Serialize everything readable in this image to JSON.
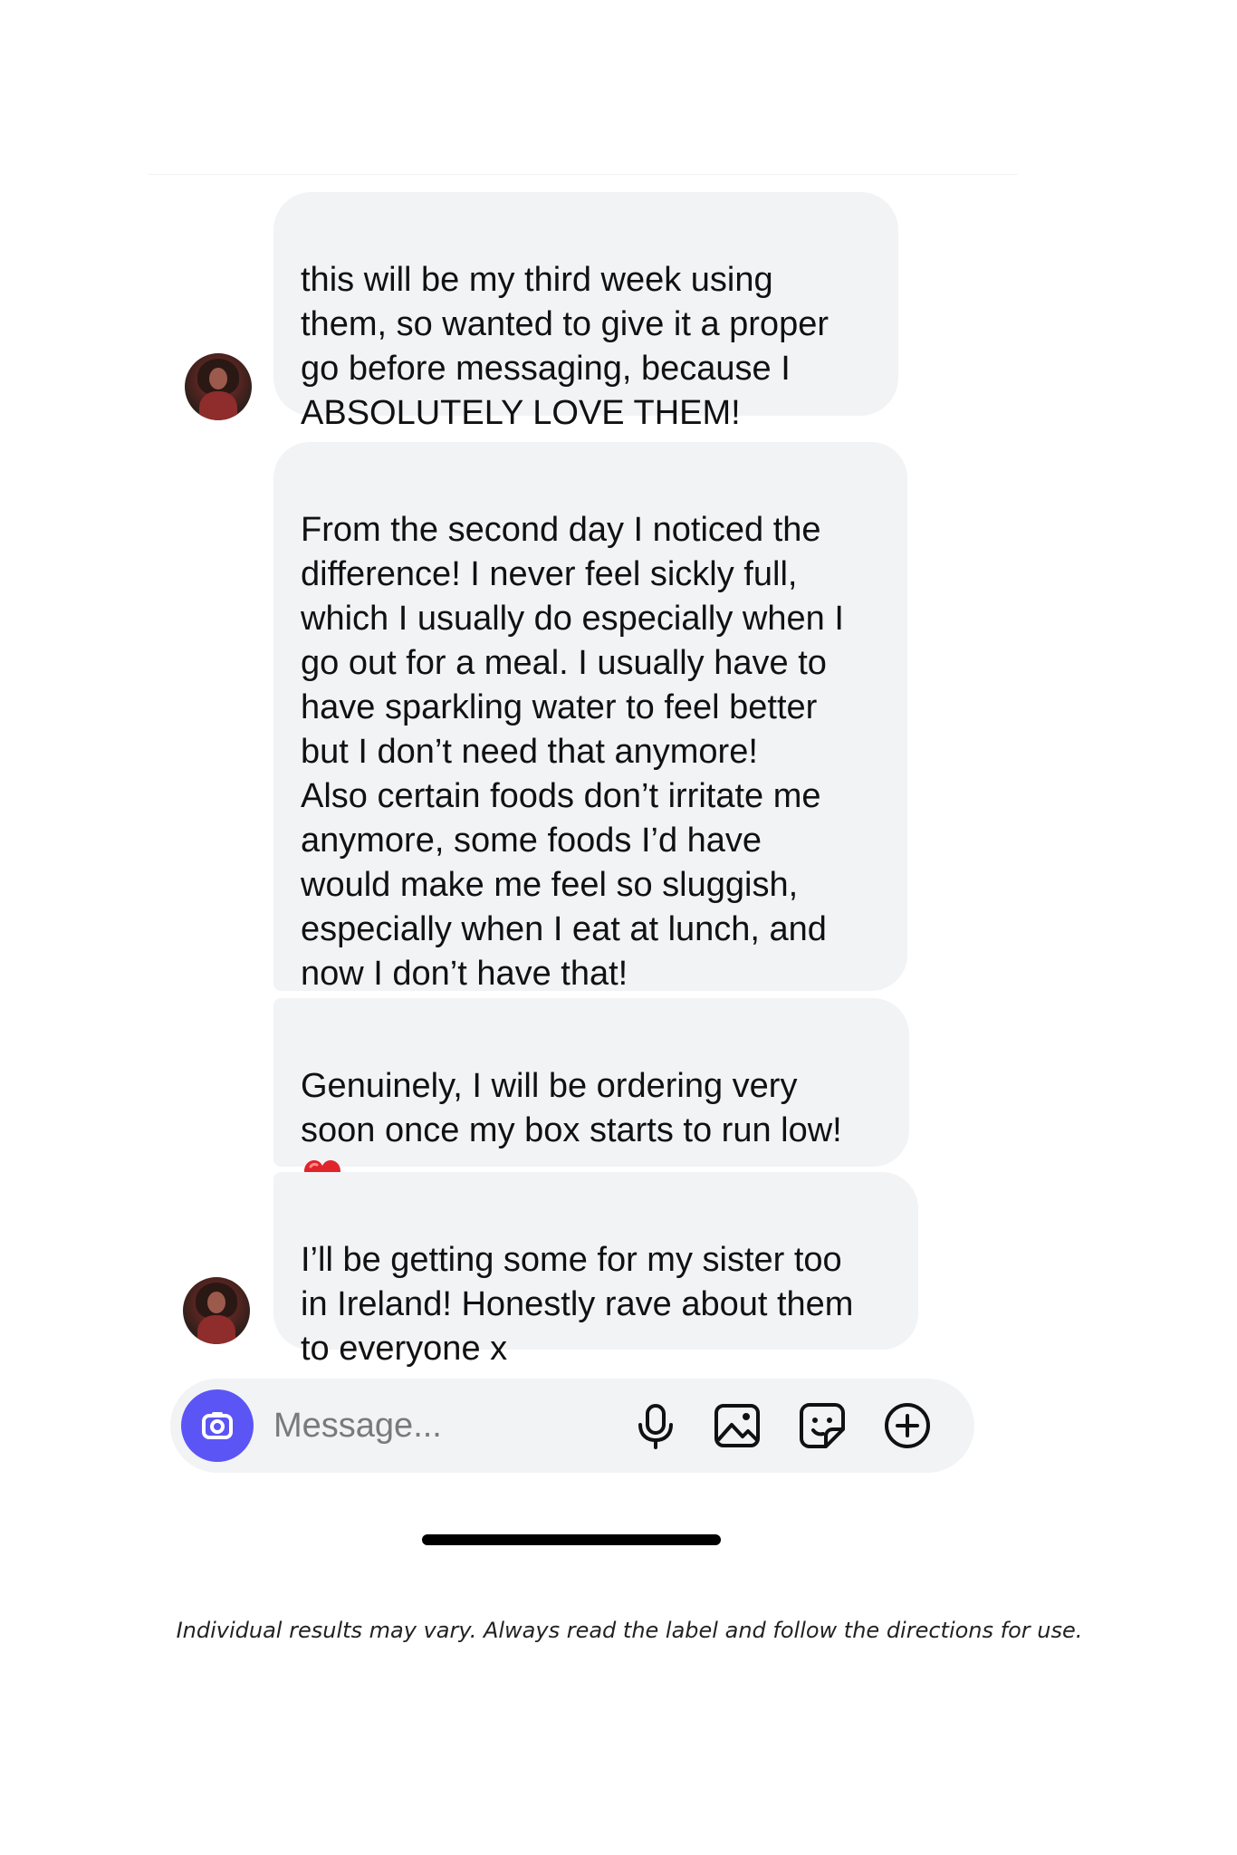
{
  "thread": {
    "messages": [
      {
        "text": "this will be my third week using\nthem, so wanted to give it a proper\ngo before messaging, because I\nABSOLUTELY LOVE THEM!"
      },
      {
        "text": "From the second day I noticed the\ndifference! I never feel sickly full,\nwhich I usually do especially when I\ngo out for a meal. I usually have to\nhave sparkling water to feel better\nbut I don’t need that anymore!\nAlso certain foods don’t irritate me\nanymore, some foods I’d have\nwould make me feel so sluggish,\nespecially when I eat at lunch, and\nnow I don’t have that!"
      },
      {
        "text": "Genuinely, I will be ordering very\nsoon once my box starts to run low!",
        "emoji": "red-heart"
      },
      {
        "text": "I’ll be getting some for my sister too\nin Ireland! Honestly rave about them\nto everyone x"
      }
    ]
  },
  "composer": {
    "placeholder": "Message...",
    "icons": [
      "camera-icon",
      "microphone-icon",
      "gallery-icon",
      "sticker-icon",
      "plus-icon"
    ],
    "camera_color": "#5b55f6"
  },
  "colors": {
    "bubble": "#f2f3f5",
    "background": "#ffffff"
  },
  "footer": {
    "disclaimer": "Individual results may vary. Always read the label and follow the directions for use."
  }
}
